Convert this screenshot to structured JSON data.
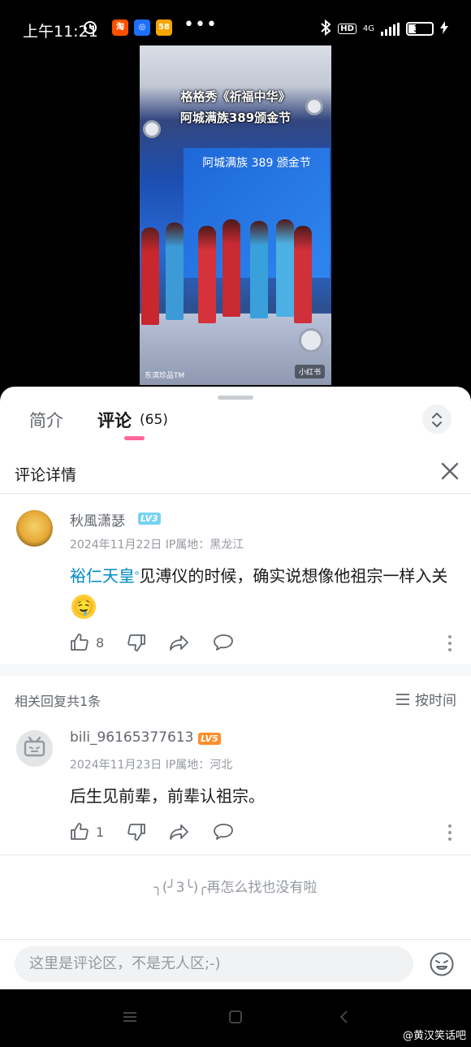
{
  "status_bar": {
    "time": "上午11:21",
    "app_icons": [
      {
        "label": "淘",
        "color": "#ff5000"
      },
      {
        "label": "◎",
        "color": "#1e6fff"
      },
      {
        "label": "58",
        "color": "#f6a400"
      }
    ],
    "more": "•••",
    "network": "4G",
    "hd": "HD",
    "battery": "30"
  },
  "video": {
    "caption_line1": "格格秀《祈福中华》",
    "caption_line2": "阿城满族389颁金节",
    "screen_text": "阿城满族 389 颁金节",
    "channel": "东滨珍品TM",
    "badge": "小红书"
  },
  "tabs": {
    "intro": "简介",
    "comments": "评论",
    "comment_count": "(65)"
  },
  "detail": {
    "title": "评论详情"
  },
  "root_comment": {
    "user": "秋風潇瑟",
    "level": "LV3",
    "level_color": "#77d2f5",
    "meta": "2024年11月22日 IP属地：黑龙江",
    "link_text": "裕仁天皇",
    "text_after_link": "见溥仪的时候，确实说想像他祖宗一样入关",
    "emoji": "🤤",
    "likes": "8"
  },
  "replies": {
    "count_label": "相关回复共1条",
    "sort_label": "按时间"
  },
  "reply": {
    "user": "bili_96165377613",
    "level": "LV5",
    "level_color": "#ff8e29",
    "meta": "2024年11月23日 IP属地：河北",
    "text": "后生见前辈，前辈认祖宗。",
    "likes": "1"
  },
  "end_note": "╮(╯3╰)╭再怎么找也没有啦",
  "input": {
    "placeholder": "这里是评论区，不是无人区;-)"
  },
  "watermark": {
    "prefix": "",
    "text": "@黄汉笑话吧"
  }
}
